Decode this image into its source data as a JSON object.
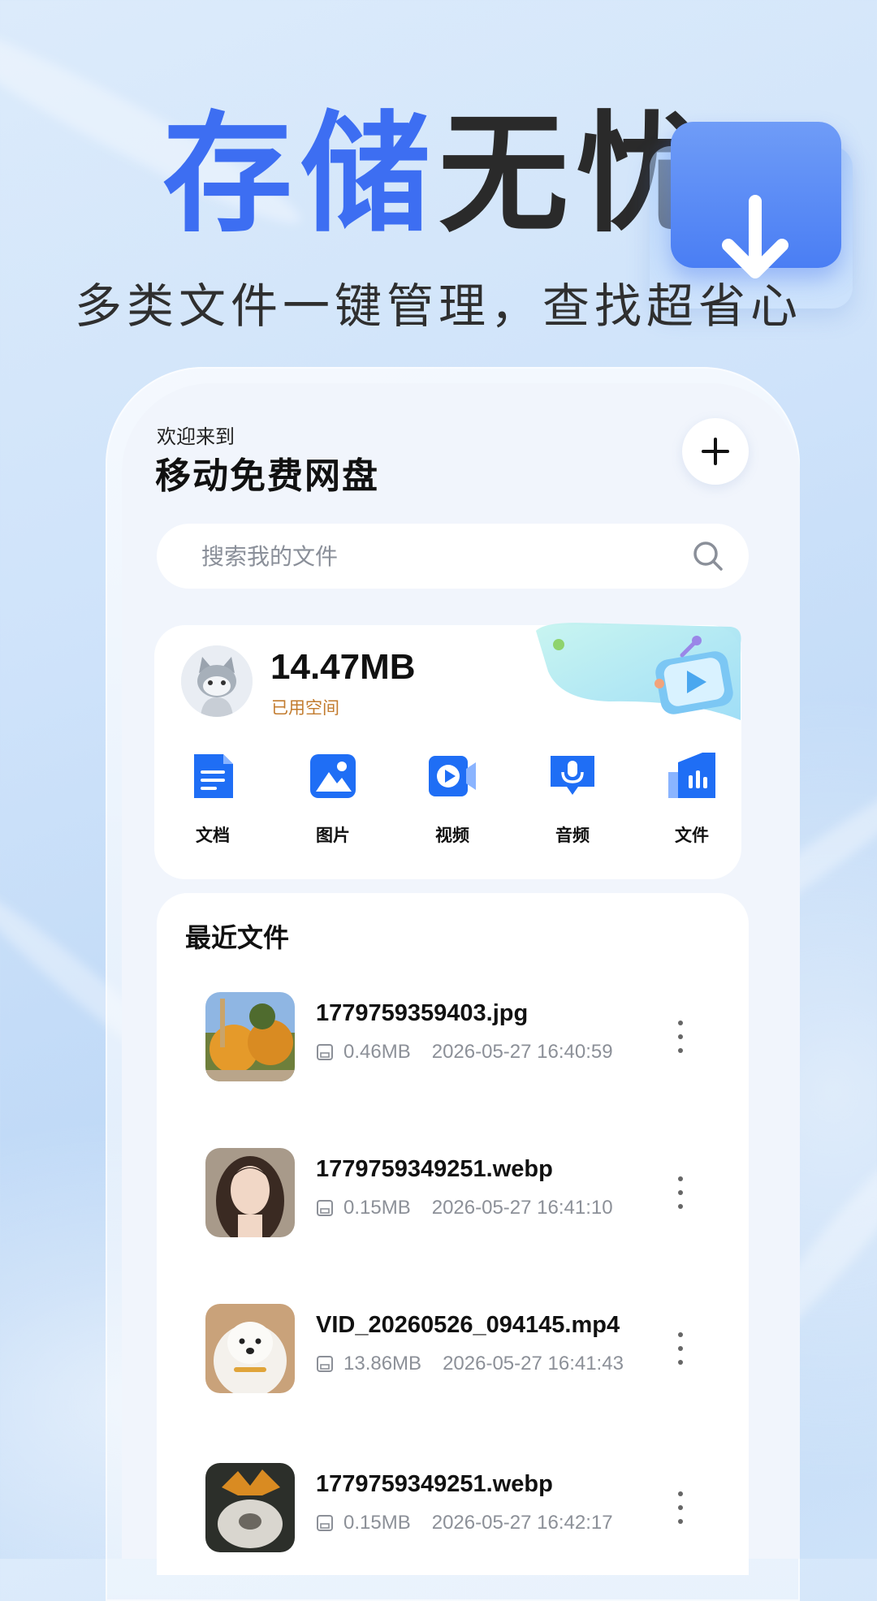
{
  "hero": {
    "title_blue": "存储",
    "title_dark": "无忧",
    "subtitle": "多类文件一键管理，查找超省心"
  },
  "header": {
    "welcome": "欢迎来到",
    "app_name": "移动免费网盘"
  },
  "search": {
    "placeholder": "搜索我的文件"
  },
  "storage": {
    "used": "14.47MB",
    "used_label": "已用空间"
  },
  "categories": [
    {
      "label": "文档",
      "icon": "document-icon"
    },
    {
      "label": "图片",
      "icon": "image-icon"
    },
    {
      "label": "视频",
      "icon": "video-icon"
    },
    {
      "label": "音频",
      "icon": "audio-icon"
    },
    {
      "label": "文件",
      "icon": "file-icon"
    }
  ],
  "recent": {
    "title": "最近文件",
    "files": [
      {
        "name": "1779759359403.jpg",
        "size": "0.46MB",
        "time": "2026-05-27 16:40:59"
      },
      {
        "name": "1779759349251.webp",
        "size": "0.15MB",
        "time": "2026-05-27 16:41:10"
      },
      {
        "name": "VID_20260526_094145.mp4",
        "size": "13.86MB",
        "time": "2026-05-27 16:41:43"
      },
      {
        "name": "1779759349251.webp",
        "size": "0.15MB",
        "time": "2026-05-27 16:42:17"
      }
    ]
  },
  "colors": {
    "accent": "#3d6ef2",
    "label_orange": "#c27b2e"
  }
}
